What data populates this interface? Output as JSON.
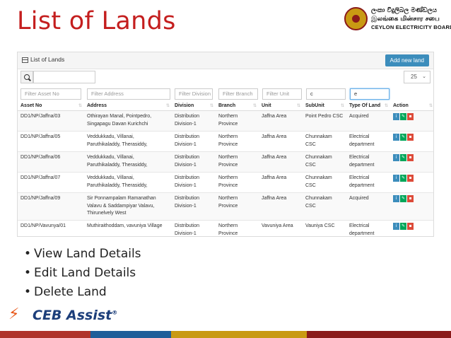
{
  "slide_title": "List of Lands",
  "logo": {
    "line1": "ලංකා විදුලිබල මණ්ඩලය",
    "line2": "இலங்கை மின்சார சபை",
    "line3": "CEYLON ELECTRICITY BOARD"
  },
  "panel": {
    "title": "List of Lands",
    "add_button": "Add new land",
    "page_size": "25"
  },
  "filters": {
    "asset_no": "Filter Asset No",
    "address": "Filter Address",
    "division": "Filter Division",
    "branch": "Filter Branch",
    "unit": "Filter Unit",
    "subunit": "c",
    "type": "e"
  },
  "table": {
    "headers": [
      "Asset No",
      "Address",
      "Division",
      "Branch",
      "Unit",
      "SubUnit",
      "Type Of Land",
      "Action"
    ],
    "rows": [
      {
        "asset": "DD1/NP/Jaffna/03",
        "address": "Othirayan Manal, Pointpedro, Singapagu Davan Kurichchi",
        "division": "Distribution Division-1",
        "branch": "Northern Province",
        "unit": "Jaffna Area",
        "subunit": "Point Pedro CSC",
        "type": "Acquired"
      },
      {
        "asset": "DD1/NP/Jaffna/05",
        "address": "Veddukkadu, Villanai, Paruthikaladdy, Therasiddy,",
        "division": "Distribution Division-1",
        "branch": "Northern Province",
        "unit": "Jaffna Area",
        "subunit": "Chunnakam CSC",
        "type": "Electrical department"
      },
      {
        "asset": "DD1/NP/Jaffna/06",
        "address": "Veddukkadu, Villanai, Paruthikaladdy, Therasiddy,",
        "division": "Distribution Division-1",
        "branch": "Northern Province",
        "unit": "Jaffna Area",
        "subunit": "Chunnakam CSC",
        "type": "Electrical department"
      },
      {
        "asset": "DD1/NP/Jaffna/07",
        "address": "Veddukkadu, Villanai, Paruthikaladdy, Therasiddy,",
        "division": "Distribution Division-1",
        "branch": "Northern Province",
        "unit": "Jaffna Area",
        "subunit": "Chunnakam CSC",
        "type": "Electrical department"
      },
      {
        "asset": "DD1/NP/Jaffna/09",
        "address": "Sir Ponnampalam Ramanathan Valavu & Saddampiyar Valavu, Thirunelvely West",
        "division": "Distribution Division-1",
        "branch": "Northern Province",
        "unit": "Jaffna Area",
        "subunit": "Chunnakam CSC",
        "type": "Acquired"
      },
      {
        "asset": "DD1/NP/Vavunya/01",
        "address": "Muthiraithoddam, vavuniya Village",
        "division": "Distribution Division-1",
        "branch": "Northern Province",
        "unit": "Vavuniya Area",
        "subunit": "Vauniya CSC",
        "type": "Electrical department"
      }
    ]
  },
  "bullets": [
    "View Land Details",
    "Edit Land Details",
    "Delete Land"
  ],
  "footer": {
    "brand": "CEB Assist",
    "brand_mark": "®"
  },
  "colors": {
    "title": "#c41e1e",
    "accent": "#3c8dbc",
    "info": "#3c8dbc",
    "edit": "#00a65a",
    "delete": "#dd4b39"
  }
}
